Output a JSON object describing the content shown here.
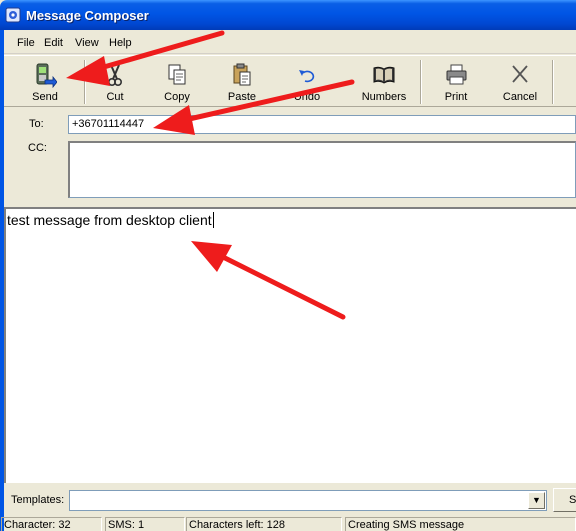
{
  "window": {
    "title": "Message Composer",
    "icon": "app-icon"
  },
  "menu": [
    "File",
    "Edit",
    "View",
    "Help"
  ],
  "toolbar": {
    "send": "Send",
    "cut": "Cut",
    "copy": "Copy",
    "paste": "Paste",
    "undo": "Undo",
    "numbers": "Numbers",
    "print": "Print",
    "cancel": "Cancel"
  },
  "address": {
    "to_label": "To:",
    "to_value": "+36701114447",
    "cc_label": "CC:",
    "cc_value": ""
  },
  "message": {
    "text": "test message from desktop client"
  },
  "templates": {
    "label": "Templates:",
    "selected": "",
    "button": "S"
  },
  "status": {
    "characters": "Character: 32",
    "sms": "SMS: 1",
    "chars_left": "Characters left: 128",
    "state": "Creating SMS message"
  },
  "colors": {
    "annotation_arrow": "#ee1c1c",
    "titlebar": "#0055e5"
  }
}
